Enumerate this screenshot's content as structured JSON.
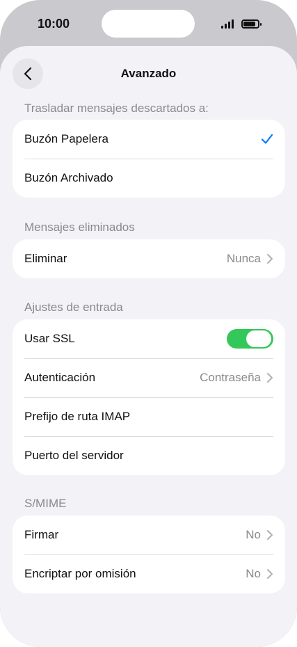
{
  "status": {
    "time": "10:00"
  },
  "nav": {
    "title": "Avanzado"
  },
  "sections": {
    "descartados": {
      "header": "Trasladar mensajes descartados a:",
      "items": [
        {
          "label": "Buzón Papelera",
          "selected": true
        },
        {
          "label": "Buzón Archivado",
          "selected": false
        }
      ]
    },
    "eliminados": {
      "header": "Mensajes eliminados",
      "items": [
        {
          "label": "Eliminar",
          "value": "Nunca"
        }
      ]
    },
    "entrada": {
      "header": "Ajustes de entrada",
      "items": [
        {
          "label": "Usar SSL",
          "toggle_on": true
        },
        {
          "label": "Autenticación",
          "value": "Contraseña"
        },
        {
          "label": "Prefijo de ruta IMAP"
        },
        {
          "label": "Puerto del servidor"
        }
      ]
    },
    "smime": {
      "header": "S/MIME",
      "items": [
        {
          "label": "Firmar",
          "value": "No"
        },
        {
          "label": "Encriptar por omisión",
          "value": "No"
        }
      ]
    }
  },
  "colors": {
    "accent": "#007aff",
    "toggle_on": "#34c759",
    "background": "#f2f2f7",
    "secondary_text": "#8a8a8e"
  },
  "icons": [
    "chevron-left-icon",
    "checkmark-icon",
    "chevron-right-icon",
    "signal-icon",
    "battery-icon"
  ]
}
